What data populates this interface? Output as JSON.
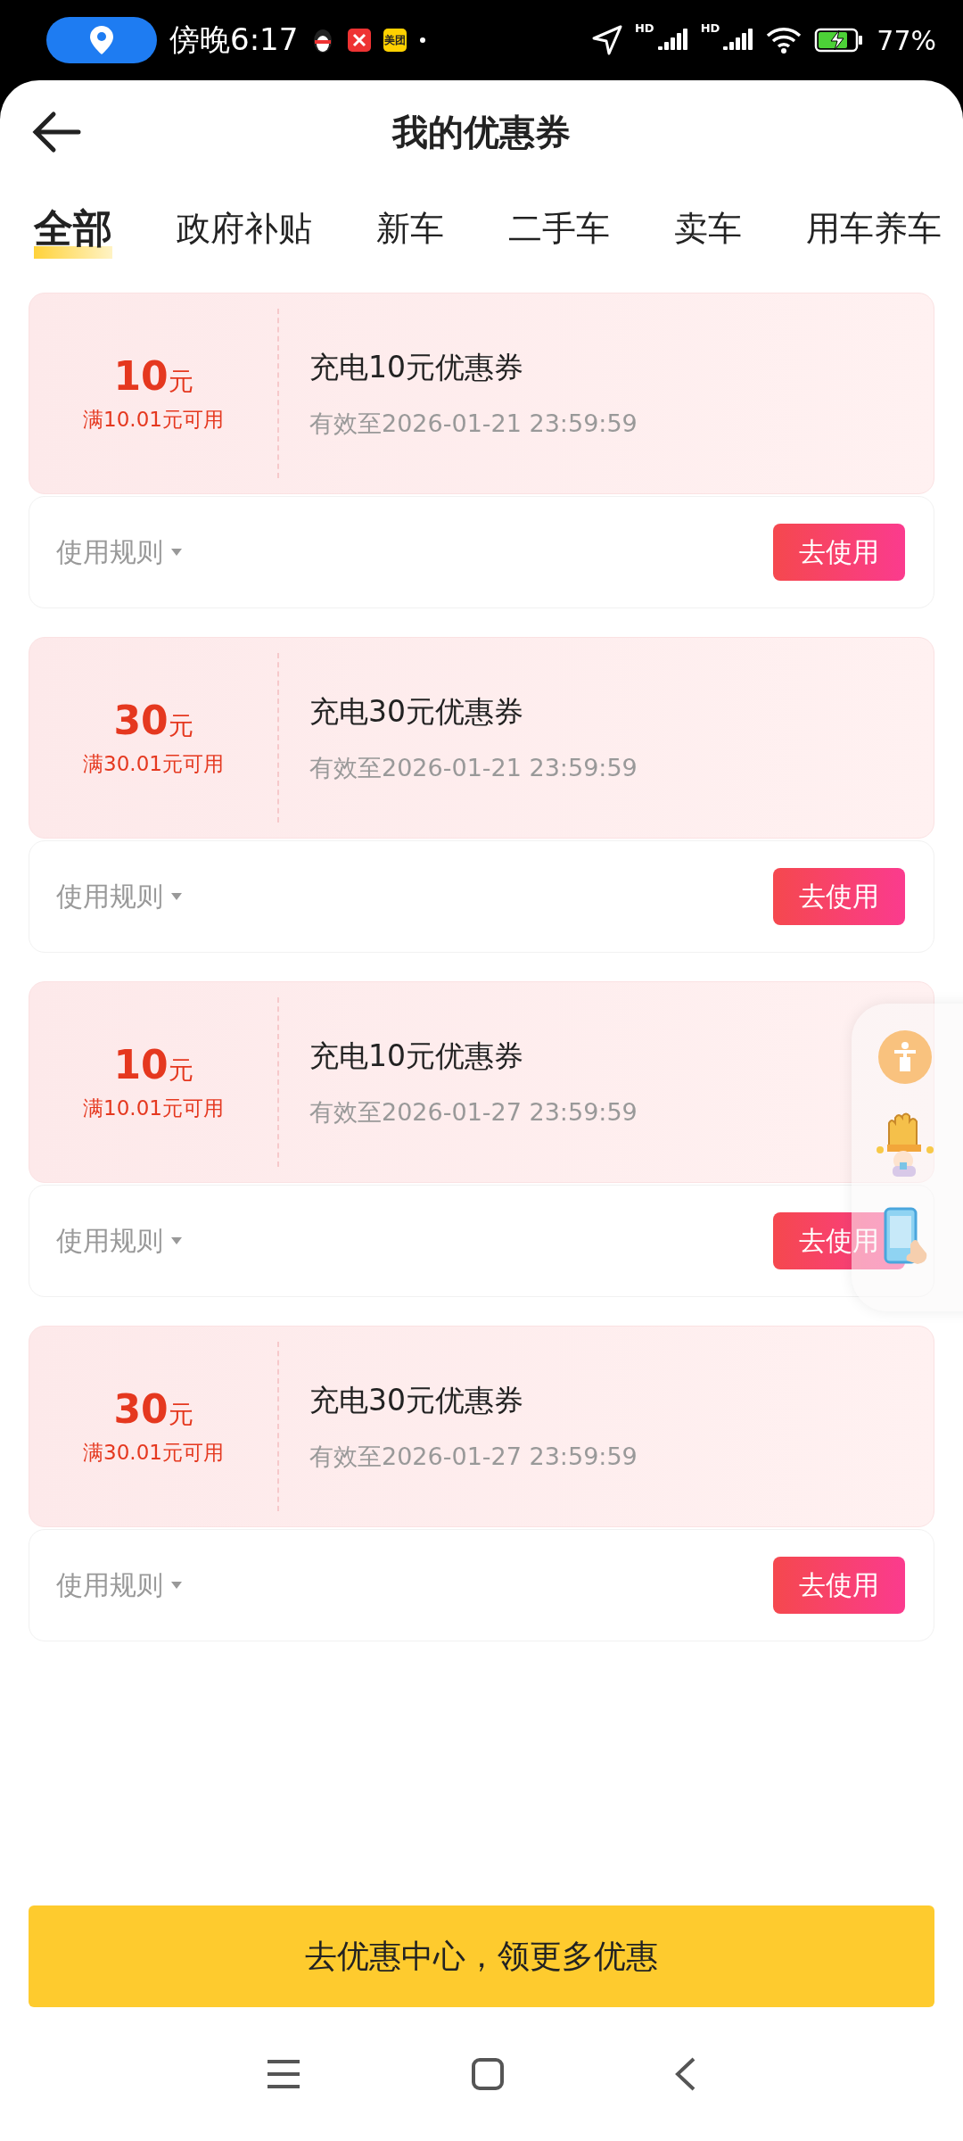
{
  "status_bar": {
    "time": "傍晚6:17",
    "app_badge": "美团",
    "network_labels": [
      "HD",
      "HD"
    ],
    "battery": "77%"
  },
  "header": {
    "title": "我的优惠券"
  },
  "tabs": [
    {
      "label": "全部",
      "selected": true
    },
    {
      "label": "政府补贴",
      "selected": false
    },
    {
      "label": "新车",
      "selected": false
    },
    {
      "label": "二手车",
      "selected": false
    },
    {
      "label": "卖车",
      "selected": false
    },
    {
      "label": "用车养车",
      "selected": false
    }
  ],
  "coupons": [
    {
      "amount": "10",
      "unit": "元",
      "condition": "满10.01元可用",
      "title": "充电10元优惠券",
      "expiry": "有效至2026-01-21 23:59:59",
      "rules": "使用规则",
      "action": "去使用"
    },
    {
      "amount": "30",
      "unit": "元",
      "condition": "满30.01元可用",
      "title": "充电30元优惠券",
      "expiry": "有效至2026-01-21 23:59:59",
      "rules": "使用规则",
      "action": "去使用"
    },
    {
      "amount": "10",
      "unit": "元",
      "condition": "满10.01元可用",
      "title": "充电10元优惠券",
      "expiry": "有效至2026-01-27 23:59:59",
      "rules": "使用规则",
      "action": "去使用"
    },
    {
      "amount": "30",
      "unit": "元",
      "condition": "满30.01元可用",
      "title": "充电30元优惠券",
      "expiry": "有效至2026-01-27 23:59:59",
      "rules": "使用规则",
      "action": "去使用"
    }
  ],
  "footer_button": "去优惠中心，领更多优惠"
}
